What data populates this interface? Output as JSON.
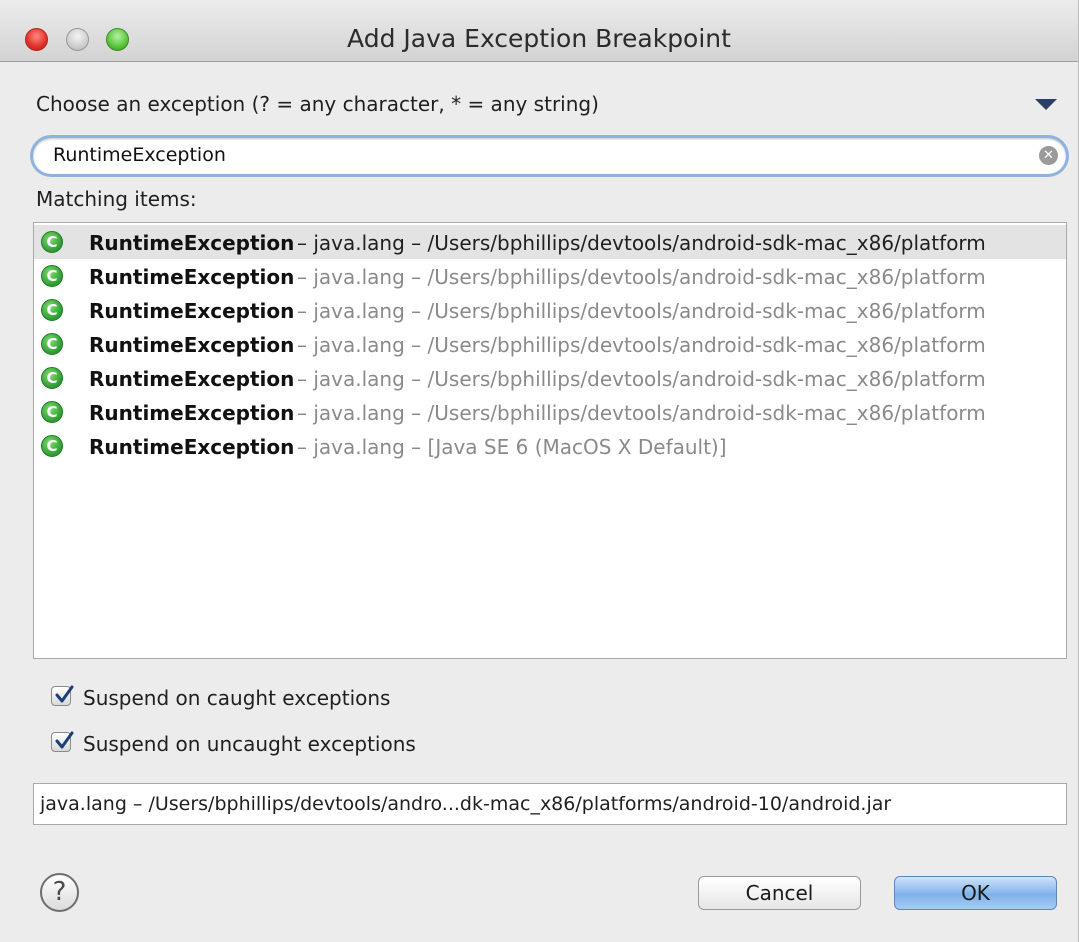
{
  "window": {
    "title": "Add Java Exception Breakpoint"
  },
  "prompt": {
    "label": "Choose an exception (? = any character, * = any string)"
  },
  "search": {
    "value": "RuntimeException"
  },
  "matching": {
    "label": "Matching items:",
    "items": [
      {
        "name": "RuntimeException",
        "detail": " – java.lang – /Users/bphillips/devtools/android-sdk-mac_x86/platform"
      },
      {
        "name": "RuntimeException",
        "detail": " – java.lang – /Users/bphillips/devtools/android-sdk-mac_x86/platform"
      },
      {
        "name": "RuntimeException",
        "detail": " – java.lang – /Users/bphillips/devtools/android-sdk-mac_x86/platform"
      },
      {
        "name": "RuntimeException",
        "detail": " – java.lang – /Users/bphillips/devtools/android-sdk-mac_x86/platform"
      },
      {
        "name": "RuntimeException",
        "detail": " – java.lang – /Users/bphillips/devtools/android-sdk-mac_x86/platform"
      },
      {
        "name": "RuntimeException",
        "detail": " – java.lang – /Users/bphillips/devtools/android-sdk-mac_x86/platform"
      },
      {
        "name": "RuntimeException",
        "detail": " – java.lang – [Java SE 6 (MacOS X Default)]"
      }
    ]
  },
  "options": {
    "caught": {
      "label": "Suspend on caught exceptions",
      "checked": true
    },
    "uncaught": {
      "label": "Suspend on uncaught exceptions",
      "checked": true
    }
  },
  "status": {
    "path": "java.lang – /Users/bphillips/devtools/andro...dk-mac_x86/platforms/android-10/android.jar"
  },
  "buttons": {
    "help": "?",
    "cancel": "Cancel",
    "ok": "OK"
  },
  "icons": {
    "class": "class-icon",
    "clear": "clear-icon",
    "dropdown": "chevron-down-icon",
    "help": "help-icon"
  },
  "colors": {
    "selection": "#e3e3e3",
    "focus_ring": "#8fb3df",
    "ok_button": "#7fb2ea",
    "class_icon": "#2e9a33"
  }
}
